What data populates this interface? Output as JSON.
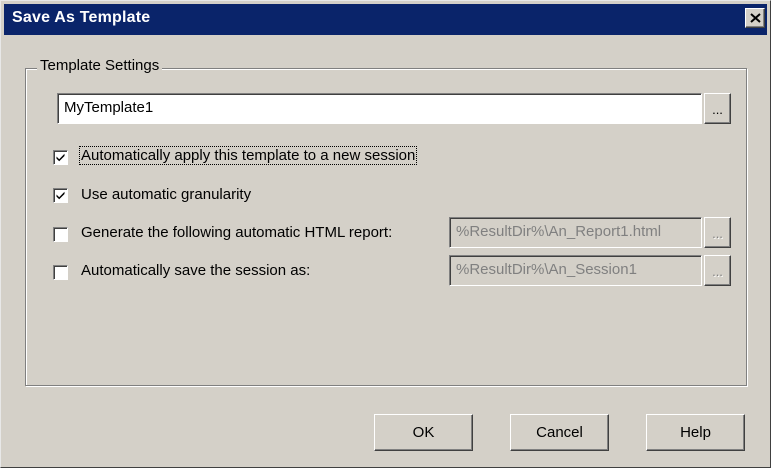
{
  "window": {
    "title": "Save As Template"
  },
  "template_settings": {
    "group_label": "Template Settings",
    "template_name": "MyTemplate1",
    "browse_label": "...",
    "options": [
      {
        "label": "Automatically apply this template to a new session",
        "checked": true
      },
      {
        "label": "Use automatic granularity",
        "checked": true
      },
      {
        "label": "Generate the following automatic HTML report:",
        "checked": false,
        "value": "%ResultDir%\\An_Report1.html"
      },
      {
        "label": "Automatically save the session as:",
        "checked": false,
        "value": "%ResultDir%\\An_Session1"
      }
    ]
  },
  "buttons": {
    "ok": "OK",
    "cancel": "Cancel",
    "help": "Help"
  }
}
